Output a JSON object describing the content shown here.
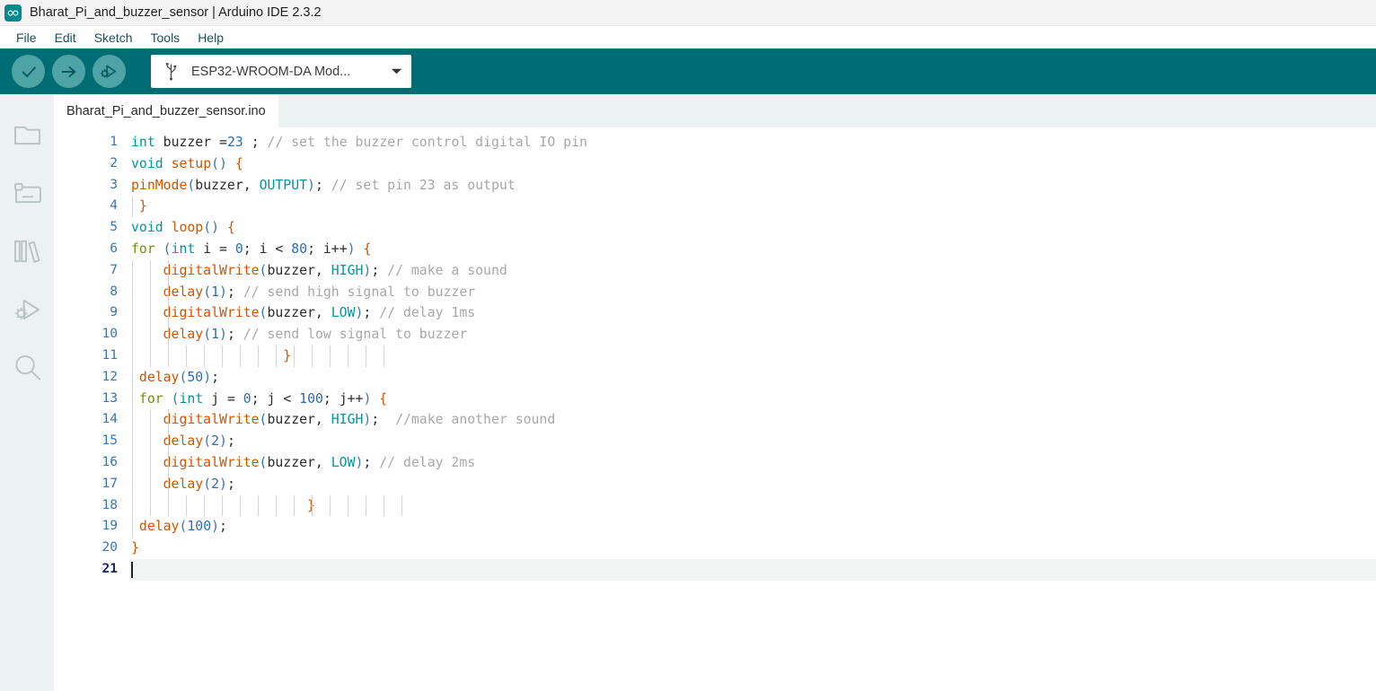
{
  "window": {
    "title": "Bharat_Pi_and_buzzer_sensor | Arduino IDE 2.3.2",
    "logo_icon": "arduino-infinity-icon"
  },
  "menubar": {
    "items": [
      {
        "label": "File"
      },
      {
        "label": "Edit"
      },
      {
        "label": "Sketch"
      },
      {
        "label": "Tools"
      },
      {
        "label": "Help"
      }
    ]
  },
  "toolbar": {
    "verify_icon": "checkmark-icon",
    "upload_icon": "arrow-right-icon",
    "debug_icon": "debug-icon",
    "board_selector": {
      "usb_icon": "usb-icon",
      "value": "ESP32-WROOM-DA Mod...",
      "caret_icon": "chevron-down-icon"
    },
    "accent_color": "#006d75",
    "button_color": "#4ea3a6"
  },
  "sidebar": {
    "items": [
      {
        "name": "sketchbook",
        "icon": "folder-icon"
      },
      {
        "name": "boards-manager",
        "icon": "boards-manager-icon"
      },
      {
        "name": "library-manager",
        "icon": "library-icon"
      },
      {
        "name": "debug",
        "icon": "debug-play-icon"
      },
      {
        "name": "search",
        "icon": "search-icon"
      }
    ]
  },
  "tabs": [
    {
      "label": "Bharat_Pi_and_buzzer_sensor.ino",
      "active": true
    }
  ],
  "editor": {
    "active_line": 21,
    "line_numbers": [
      1,
      2,
      3,
      4,
      5,
      6,
      7,
      8,
      9,
      10,
      11,
      12,
      13,
      14,
      15,
      16,
      17,
      18,
      19,
      20,
      21
    ],
    "lines": [
      {
        "n": 1,
        "text": "int buzzer =23 ; // set the buzzer control digital IO pin"
      },
      {
        "n": 2,
        "text": "void setup() {"
      },
      {
        "n": 3,
        "text": "pinMode(buzzer, OUTPUT); // set pin 23 as output"
      },
      {
        "n": 4,
        "text": " }"
      },
      {
        "n": 5,
        "text": "void loop() {"
      },
      {
        "n": 6,
        "text": "for (int i = 0; i < 80; i++) {"
      },
      {
        "n": 7,
        "text": "    digitalWrite(buzzer, HIGH); // make a sound"
      },
      {
        "n": 8,
        "text": "    delay(1); // send high signal to buzzer"
      },
      {
        "n": 9,
        "text": "    digitalWrite(buzzer, LOW); // delay 1ms"
      },
      {
        "n": 10,
        "text": "    delay(1); // send low signal to buzzer"
      },
      {
        "n": 11,
        "text": "                   }"
      },
      {
        "n": 12,
        "text": " delay(50);"
      },
      {
        "n": 13,
        "text": " for (int j = 0; j < 100; j++) {"
      },
      {
        "n": 14,
        "text": "    digitalWrite(buzzer, HIGH);  //make another sound"
      },
      {
        "n": 15,
        "text": "    delay(2);"
      },
      {
        "n": 16,
        "text": "    digitalWrite(buzzer, LOW); // delay 2ms"
      },
      {
        "n": 17,
        "text": "    delay(2);"
      },
      {
        "n": 18,
        "text": "                      }"
      },
      {
        "n": 19,
        "text": " delay(100);"
      },
      {
        "n": 20,
        "text": "}"
      },
      {
        "n": 21,
        "text": ""
      }
    ]
  },
  "colors": {
    "toolbar_bg": "#006d75",
    "sidebar_bg": "#ecf1f1",
    "tabbar_bg": "#ecf1f1",
    "keyword": "#00979c",
    "function": "#d35400",
    "comment": "#a8a8a8",
    "number": "#2d6cb3",
    "linenum": "#3b76b0"
  }
}
